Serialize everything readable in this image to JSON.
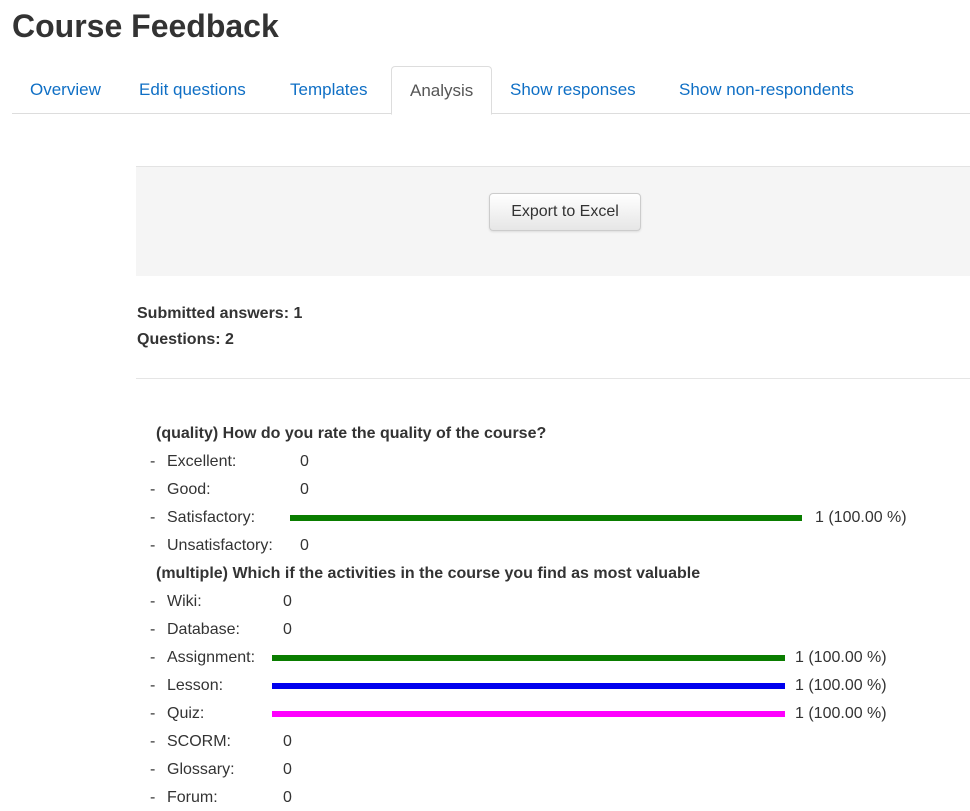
{
  "page_title": "Course Feedback",
  "tabs": [
    {
      "label": "Overview"
    },
    {
      "label": "Edit questions"
    },
    {
      "label": "Templates"
    },
    {
      "label": "Analysis"
    },
    {
      "label": "Show responses"
    },
    {
      "label": "Show non-respondents"
    }
  ],
  "export_button_label": "Export to Excel",
  "summary": {
    "submitted": "Submitted answers: 1",
    "questions": "Questions: 2"
  },
  "questions": [
    {
      "title": "(quality) How do you rate the quality of the course?",
      "answers": [
        {
          "dash": "-",
          "label": "Excellent:",
          "count": 0,
          "result": "0",
          "color": null
        },
        {
          "dash": "-",
          "label": "Good:",
          "count": 0,
          "result": "0",
          "color": null
        },
        {
          "dash": "-",
          "label": "Satisfactory:",
          "count": 1,
          "percent": 100,
          "result": "1 (100.00 %)",
          "color": "#0a7d00"
        },
        {
          "dash": "-",
          "label": "Unsatisfactory:",
          "count": 0,
          "result": "0",
          "color": null
        }
      ]
    },
    {
      "title": "(multiple) Which if the activities in the course you find as most valuable",
      "answers": [
        {
          "dash": "-",
          "label": "Wiki:",
          "count": 0,
          "result": "0",
          "color": null
        },
        {
          "dash": "-",
          "label": "Database:",
          "count": 0,
          "result": "0",
          "color": null
        },
        {
          "dash": "-",
          "label": "Assignment:",
          "count": 1,
          "percent": 100,
          "result": "1 (100.00 %)",
          "color": "#0a7d00"
        },
        {
          "dash": "-",
          "label": "Lesson:",
          "count": 1,
          "percent": 100,
          "result": "1 (100.00 %)",
          "color": "#0000ee"
        },
        {
          "dash": "-",
          "label": "Quiz:",
          "count": 1,
          "percent": 100,
          "result": "1 (100.00 %)",
          "color": "#ff00ff"
        },
        {
          "dash": "-",
          "label": "SCORM:",
          "count": 0,
          "result": "0",
          "color": null
        },
        {
          "dash": "-",
          "label": "Glossary:",
          "count": 0,
          "result": "0",
          "color": null
        },
        {
          "dash": "-",
          "label": "Forum:",
          "count": 0,
          "result": "0",
          "color": null
        }
      ]
    }
  ],
  "colors": {
    "link": "#0f6fc5",
    "text": "#333333",
    "panel": "#f5f5f5"
  }
}
